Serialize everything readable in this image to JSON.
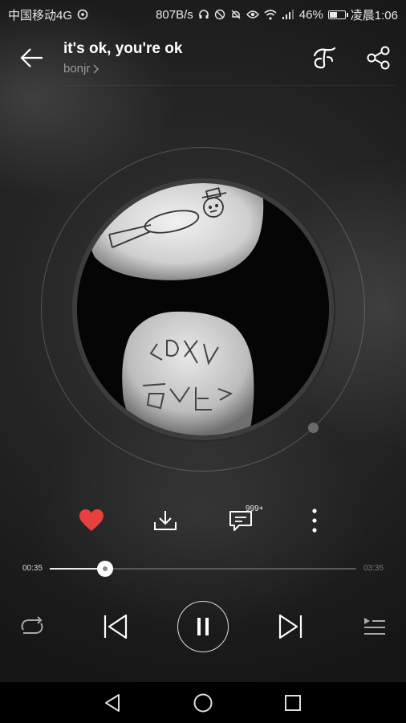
{
  "status_bar": {
    "carrier": "中国移动4G",
    "net_speed": "807B/s",
    "battery": "46%",
    "time": "凌晨1:06"
  },
  "header": {
    "title": "it's ok, you're ok",
    "artist": "bonjr",
    "icons": [
      "back-arrow-icon",
      "song-tone-icon",
      "share-icon"
    ]
  },
  "actions": {
    "comment_count": "999+",
    "icons": [
      "heart-icon",
      "download-icon",
      "comment-icon",
      "more-vertical-icon"
    ]
  },
  "playback": {
    "current_time": "00:35",
    "total_time": "03:35",
    "progress": 0.18
  },
  "transport": {
    "icons": [
      "repeat-icon",
      "previous-icon",
      "pause-icon",
      "next-icon",
      "playlist-icon"
    ]
  },
  "navigation": {
    "icons": [
      "nav-back-icon",
      "nav-home-icon",
      "nav-recents-icon"
    ]
  },
  "colors": {
    "accent_heart": "#e8403c",
    "text_primary": "#ffffff",
    "text_secondary": "#9a9a9a"
  }
}
